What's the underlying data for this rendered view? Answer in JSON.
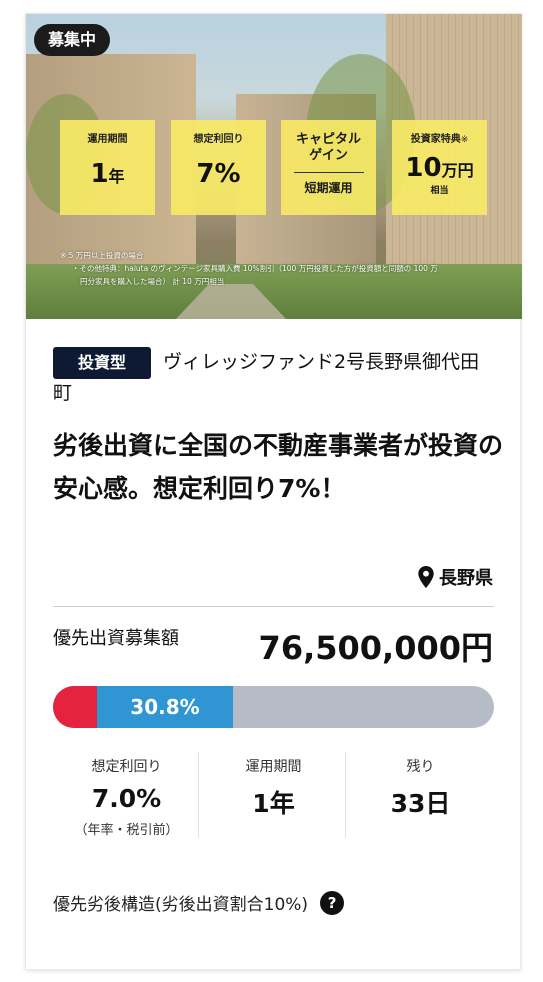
{
  "hero": {
    "badge": "募集中",
    "boxes": [
      {
        "label": "運用期間",
        "value": "1",
        "unit": "年"
      },
      {
        "label": "想定利回り",
        "value": "7%",
        "unit": ""
      },
      {
        "top": "キャピタル\nゲイン",
        "bottom": "短期運用"
      },
      {
        "label": "投資家特典",
        "label_mark": "※",
        "value": "10",
        "unit": "万円",
        "sub": "相当"
      }
    ],
    "notes": [
      "※ 5 万円以上投資の場合",
      "・その他特典：haluta のヴィンテージ家具購入費 10%割引（100 万円投資した方が投資額と同額の 100 万",
      "円分家具を購入した場合） 計 10 万円相当"
    ]
  },
  "fund": {
    "type_tag": "投資型",
    "name": "ヴィレッジファンド2号長野県御代田町",
    "headline": "劣後出資に全国の不動産事業者が投資の安心感。想定利回り7%！",
    "location": "長野県",
    "amount_label": "優先出資募集額",
    "amount_value": "76,500,000円",
    "progress": {
      "red_fraction": 0.1,
      "blue_fraction": 0.308,
      "label": "30.8%"
    }
  },
  "stats": [
    {
      "label": "想定利回り",
      "value": "7.0%",
      "note": "（年率・税引前）"
    },
    {
      "label": "運用期間",
      "value": "1年",
      "note": ""
    },
    {
      "label": "残り",
      "value": "33日",
      "note": ""
    }
  ],
  "structure": {
    "text": "優先劣後構造(劣後出資割合10%)",
    "help_icon": "question-circle-icon"
  },
  "colors": {
    "tag_bg": "#0e1a33",
    "red": "#e6233e",
    "blue": "#2f96d3",
    "bar_bg": "#b5bcc6",
    "box": "#f7e966"
  }
}
